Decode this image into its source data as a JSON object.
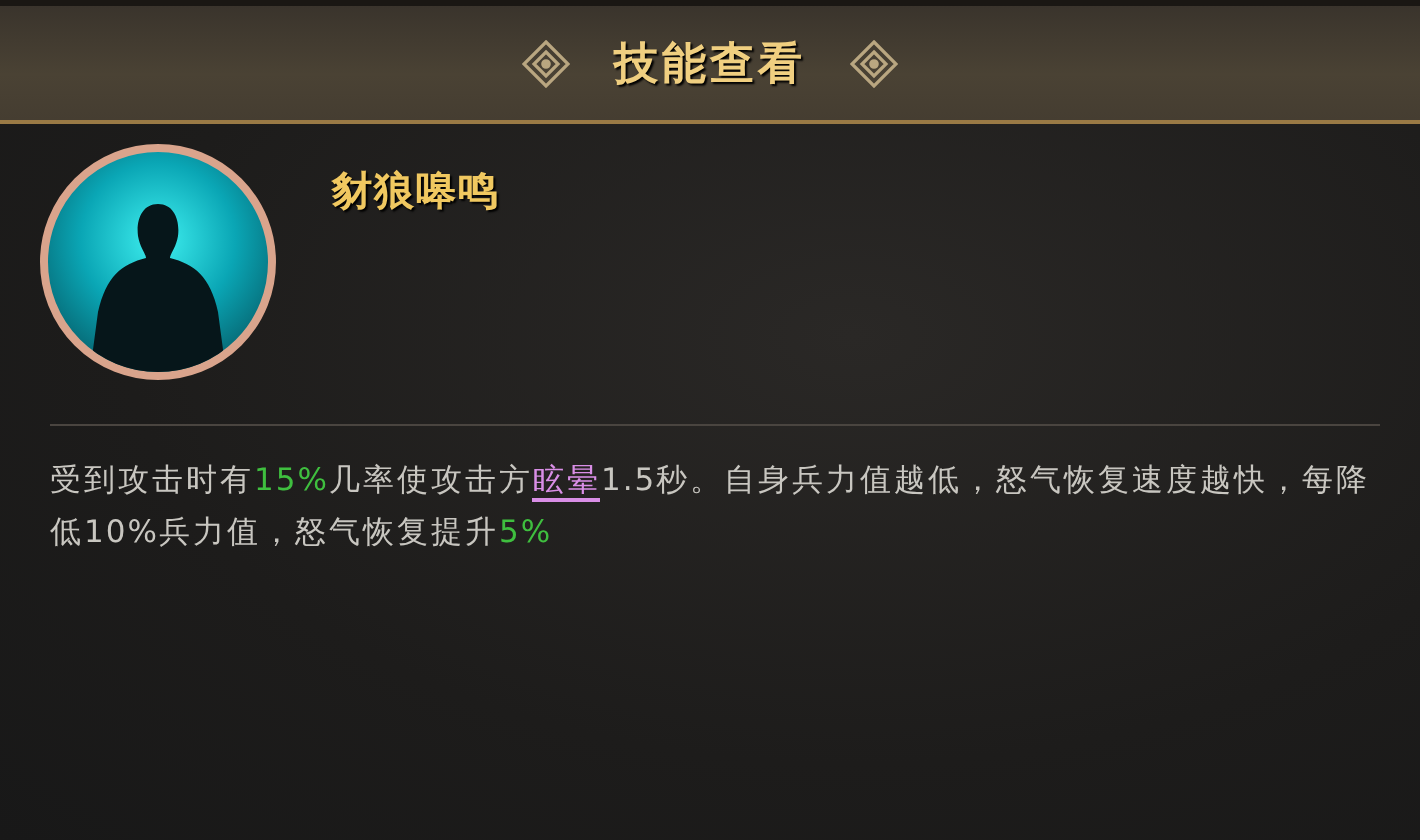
{
  "header": {
    "title": "技能查看"
  },
  "skill": {
    "name": "豺狼嗥鸣",
    "description": [
      {
        "kind": "plain",
        "text": "受到攻击时有"
      },
      {
        "kind": "value",
        "text": "15%"
      },
      {
        "kind": "plain",
        "text": "几率使攻击方"
      },
      {
        "kind": "keyword",
        "text": "眩晕"
      },
      {
        "kind": "plain",
        "text": "1.5秒。自身兵力值越低，怒气恢复速度越快，每降低10%兵力值，怒气恢复提升"
      },
      {
        "kind": "value",
        "text": "5%"
      }
    ]
  }
}
